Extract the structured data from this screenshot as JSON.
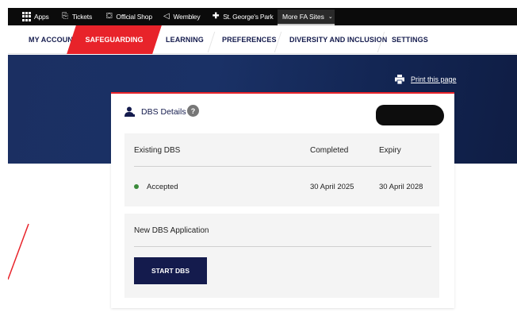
{
  "topbar": {
    "apps": "Apps",
    "tickets": "Tickets",
    "official_shop": "Official Shop",
    "wembley": "Wembley",
    "st_georges": "St. George's Park",
    "more_sites": "More FA Sites"
  },
  "tabs": [
    {
      "label": "MY ACCOUNT"
    },
    {
      "label": "SAFEGUARDING",
      "active": true
    },
    {
      "label": "LEARNING"
    },
    {
      "label": "PREFERENCES"
    },
    {
      "label": "DIVERSITY AND INCLUSION"
    },
    {
      "label": "SETTINGS"
    }
  ],
  "print_label": "Print this page",
  "card": {
    "title": "DBS Details",
    "help": "?",
    "existing": {
      "heading": "Existing DBS",
      "col_completed": "Completed",
      "col_expiry": "Expiry",
      "status": "Accepted",
      "status_color": "#3a8a3a",
      "completed": "30 April 2025",
      "expiry": "30 April 2028"
    },
    "new_application": {
      "heading": "New DBS Application",
      "button": "START DBS"
    }
  },
  "colors": {
    "brand_navy": "#141b4d",
    "brand_red": "#e8232a"
  }
}
